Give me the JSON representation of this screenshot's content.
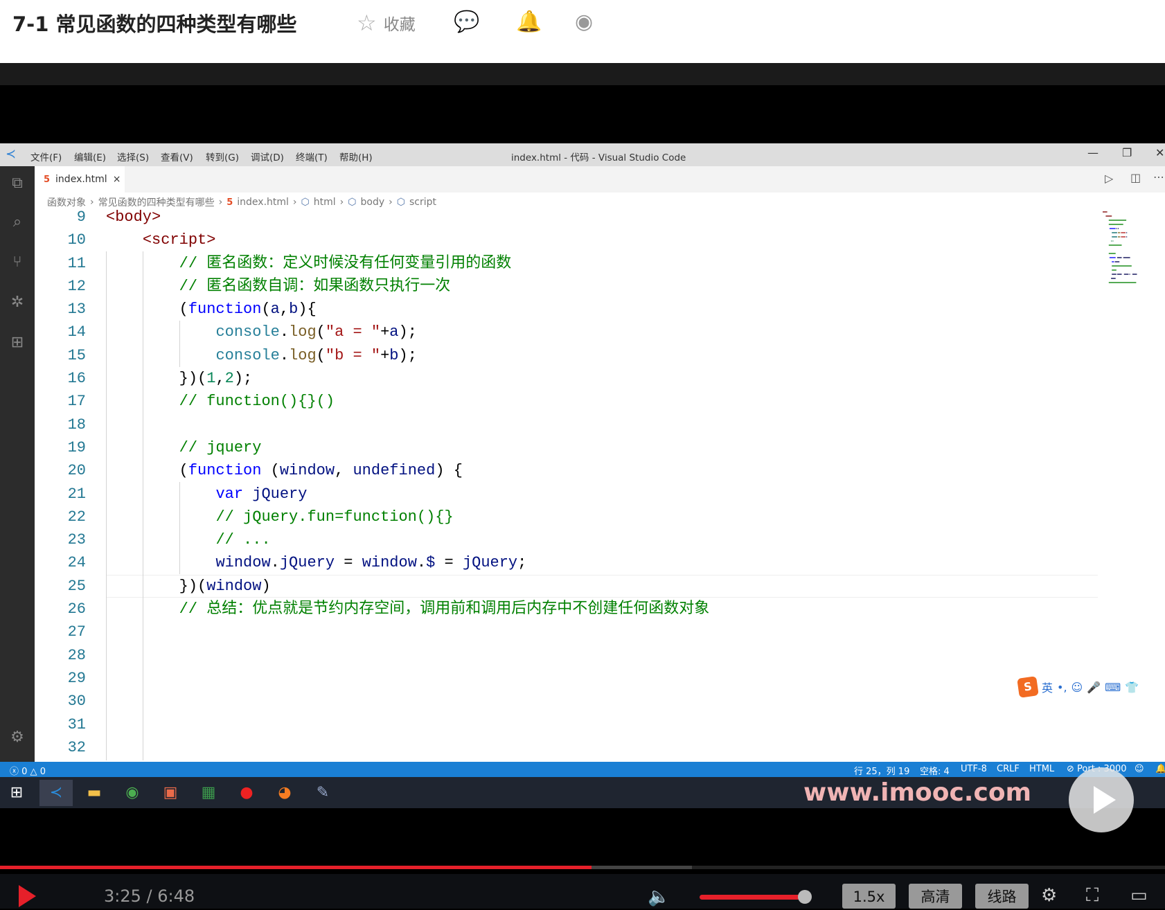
{
  "page": {
    "title": "7-1 常见函数的四种类型有哪些",
    "favorite_label": "收藏",
    "share_icons": [
      "wechat-icon",
      "qq-icon",
      "weibo-icon"
    ]
  },
  "vscode": {
    "menu": [
      "文件(F)",
      "编辑(E)",
      "选择(S)",
      "查看(V)",
      "转到(G)",
      "调试(D)",
      "终端(T)",
      "帮助(H)"
    ],
    "window_title": "index.html - 代码 - Visual Studio Code",
    "tab": {
      "label": "index.html",
      "close": "×"
    },
    "breadcrumbs": [
      "函数对象",
      "常见函数的四种类型有哪些",
      "index.html",
      "html",
      "body",
      "script"
    ],
    "code": [
      {
        "n": "9",
        "t": [
          [
            "tag",
            "<body>"
          ]
        ]
      },
      {
        "n": "10",
        "t": [
          [
            "",
            "    "
          ],
          [
            "tag",
            "<script>"
          ]
        ]
      },
      {
        "n": "11",
        "t": [
          [
            "",
            "        "
          ],
          [
            "com",
            "// 匿名函数：定义时候没有任何变量引用的函数"
          ]
        ]
      },
      {
        "n": "12",
        "t": [
          [
            "",
            "        "
          ],
          [
            "com",
            "// 匿名函数自调：如果函数只执行一次"
          ]
        ]
      },
      {
        "n": "13",
        "t": [
          [
            "",
            "        ("
          ],
          [
            "kw",
            "function"
          ],
          [
            "",
            "("
          ],
          [
            "var",
            "a"
          ],
          [
            "",
            ","
          ],
          [
            "var",
            "b"
          ],
          [
            "",
            "){"
          ]
        ]
      },
      {
        "n": "14",
        "t": [
          [
            "",
            "            "
          ],
          [
            "type",
            "console"
          ],
          [
            "",
            "."
          ],
          [
            "fn",
            "log"
          ],
          [
            "",
            "("
          ],
          [
            "str",
            "\"a = \""
          ],
          [
            "",
            "+"
          ],
          [
            "var",
            "a"
          ],
          [
            "",
            ");"
          ]
        ]
      },
      {
        "n": "15",
        "t": [
          [
            "",
            "            "
          ],
          [
            "type",
            "console"
          ],
          [
            "",
            "."
          ],
          [
            "fn",
            "log"
          ],
          [
            "",
            "("
          ],
          [
            "str",
            "\"b = \""
          ],
          [
            "",
            "+"
          ],
          [
            "var",
            "b"
          ],
          [
            "",
            ");"
          ]
        ]
      },
      {
        "n": "16",
        "t": [
          [
            "",
            "        })("
          ],
          [
            "num",
            "1"
          ],
          [
            "",
            ","
          ],
          [
            "num",
            "2"
          ],
          [
            "",
            ");"
          ]
        ]
      },
      {
        "n": "17",
        "t": [
          [
            "",
            "        "
          ],
          [
            "com",
            "// function(){}()"
          ]
        ]
      },
      {
        "n": "18",
        "t": []
      },
      {
        "n": "19",
        "t": [
          [
            "",
            "        "
          ],
          [
            "com",
            "// jquery"
          ]
        ]
      },
      {
        "n": "20",
        "t": [
          [
            "",
            "        ("
          ],
          [
            "kw",
            "function"
          ],
          [
            "",
            " ("
          ],
          [
            "var",
            "window"
          ],
          [
            "",
            ", "
          ],
          [
            "var",
            "undefined"
          ],
          [
            "",
            ") {"
          ]
        ]
      },
      {
        "n": "21",
        "t": [
          [
            "",
            "            "
          ],
          [
            "kw",
            "var"
          ],
          [
            "",
            " "
          ],
          [
            "var",
            "jQuery"
          ]
        ]
      },
      {
        "n": "22",
        "t": [
          [
            "",
            "            "
          ],
          [
            "com",
            "// jQuery.fun=function(){}"
          ]
        ]
      },
      {
        "n": "23",
        "t": [
          [
            "",
            "            "
          ],
          [
            "com",
            "// ..."
          ]
        ]
      },
      {
        "n": "24",
        "t": [
          [
            "",
            "            "
          ],
          [
            "var",
            "window"
          ],
          [
            "",
            "."
          ],
          [
            "var",
            "jQuery"
          ],
          [
            "",
            " = "
          ],
          [
            "var",
            "window"
          ],
          [
            "",
            "."
          ],
          [
            "var",
            "$"
          ],
          [
            "",
            " = "
          ],
          [
            "var",
            "jQuery"
          ],
          [
            "",
            ";"
          ]
        ]
      },
      {
        "n": "25",
        "t": [
          [
            "",
            "        })("
          ],
          [
            "var",
            "window"
          ],
          [
            "",
            ")"
          ]
        ]
      },
      {
        "n": "26",
        "t": [
          [
            "",
            "        "
          ],
          [
            "com",
            "// 总结：优点就是节约内存空间，调用前和调用后内存中不创建任何函数对象"
          ]
        ]
      },
      {
        "n": "27",
        "t": []
      },
      {
        "n": "28",
        "t": []
      },
      {
        "n": "29",
        "t": []
      },
      {
        "n": "30",
        "t": []
      },
      {
        "n": "31",
        "t": []
      },
      {
        "n": "32",
        "t": []
      }
    ],
    "ime": {
      "lang": "英",
      "punct": "•,"
    },
    "status": {
      "errors": "0",
      "warnings": "0",
      "position": "行 25，列 19",
      "spaces": "空格: 4",
      "encoding": "UTF-8",
      "eol": "CRLF",
      "language": "HTML",
      "port": "Port : 3000"
    }
  },
  "watermark": "www.imooc.com",
  "player": {
    "current": "3:25",
    "duration": "6:48",
    "time_text": "3:25 / 6:48",
    "progress_fraction": 0.508,
    "buffered_fraction": 0.594,
    "volume_fraction": 0.95,
    "speed": "1.5x",
    "quality": "高清",
    "route": "线路"
  }
}
